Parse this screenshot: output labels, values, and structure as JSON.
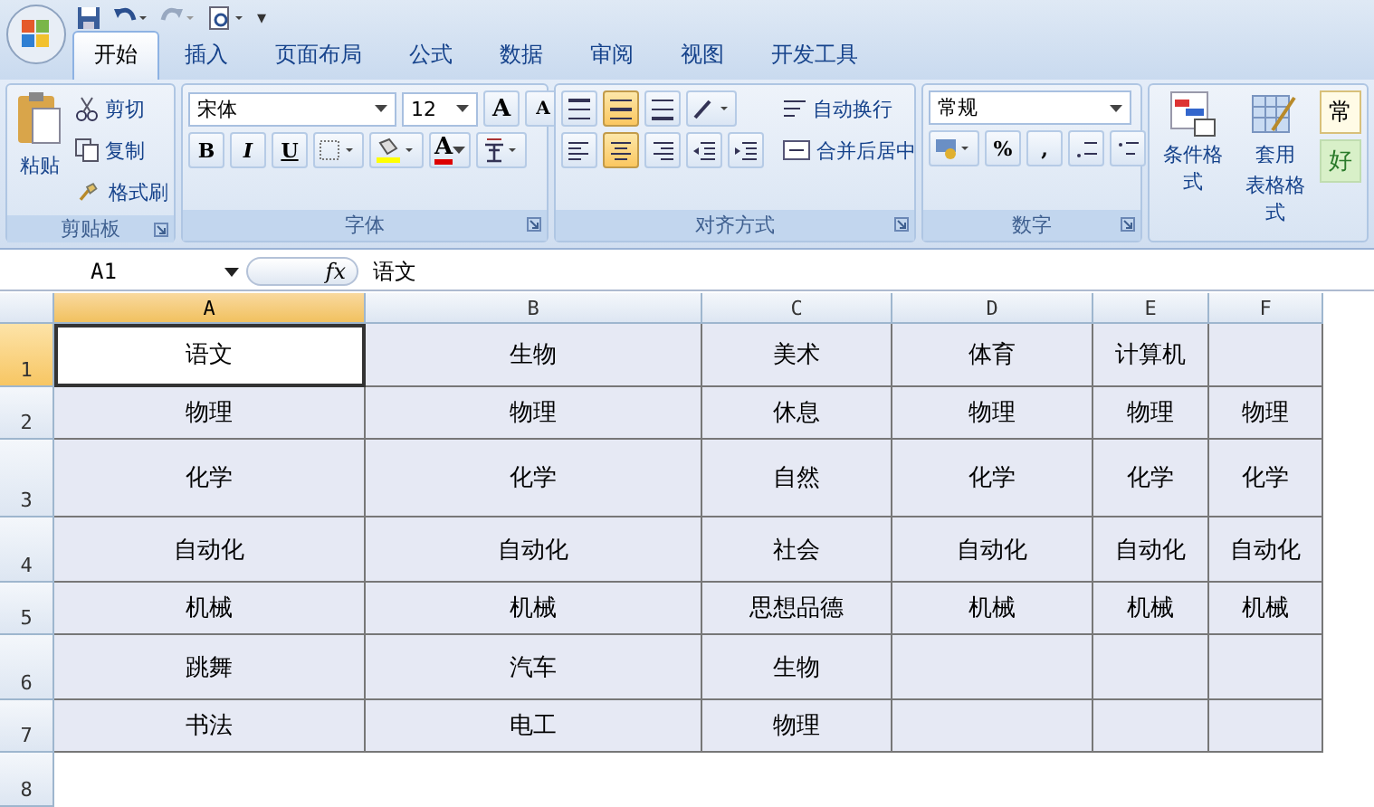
{
  "quick_access": {
    "more": "▾"
  },
  "tabs": [
    {
      "label": "开始",
      "selected": true
    },
    {
      "label": "插入",
      "selected": false
    },
    {
      "label": "页面布局",
      "selected": false
    },
    {
      "label": "公式",
      "selected": false
    },
    {
      "label": "数据",
      "selected": false
    },
    {
      "label": "审阅",
      "selected": false
    },
    {
      "label": "视图",
      "selected": false
    },
    {
      "label": "开发工具",
      "selected": false
    }
  ],
  "clipboard": {
    "title": "剪贴板",
    "paste": "粘贴",
    "cut": "剪切",
    "copy": "复制",
    "format_painter": "格式刷"
  },
  "font": {
    "title": "字体",
    "font_name": "宋体",
    "font_size": "12",
    "grow": "A",
    "shrink": "A",
    "bold": "B",
    "italic": "I",
    "underline": "U",
    "font_color": "A"
  },
  "alignment": {
    "title": "对齐方式",
    "vertical": [
      {
        "selected": false
      },
      {
        "selected": true
      },
      {
        "selected": false
      }
    ],
    "horizontal": [
      {
        "selected": false
      },
      {
        "selected": true
      },
      {
        "selected": false
      }
    ],
    "wrap_text": "自动换行",
    "merge_center": "合并后居中"
  },
  "number": {
    "title": "数字",
    "format": "常规",
    "percent": "%",
    "comma": ","
  },
  "styles": {
    "conditional_format": "条件格式",
    "table_format": [
      "套用",
      "表格格式"
    ],
    "cell_styles": [
      "常",
      "好"
    ]
  },
  "formula_bar": {
    "name_box": "A1",
    "fx": "fx",
    "formula": "语文"
  },
  "sheet": {
    "columns": [
      {
        "label": "A",
        "selected": true
      },
      {
        "label": "B",
        "selected": false
      },
      {
        "label": "C",
        "selected": false
      },
      {
        "label": "D",
        "selected": false
      },
      {
        "label": "E",
        "selected": false
      },
      {
        "label": "F",
        "selected": false
      }
    ],
    "rows": [
      {
        "header": "1",
        "selected": true,
        "cells": [
          {
            "text": "语文",
            "selected": true
          },
          {
            "text": "生物",
            "selected": false
          },
          {
            "text": "美术",
            "selected": false
          },
          {
            "text": "体育",
            "selected": false
          },
          {
            "text": "计算机",
            "selected": false
          },
          {
            "text": "",
            "selected": false
          }
        ]
      },
      {
        "header": "2",
        "selected": false,
        "cells": [
          {
            "text": "物理",
            "selected": false
          },
          {
            "text": "物理",
            "selected": false
          },
          {
            "text": "休息",
            "selected": false
          },
          {
            "text": "物理",
            "selected": false
          },
          {
            "text": "物理",
            "selected": false
          },
          {
            "text": "物理",
            "selected": false
          }
        ]
      },
      {
        "header": "3",
        "selected": false,
        "cells": [
          {
            "text": "化学",
            "selected": false
          },
          {
            "text": "化学",
            "selected": false
          },
          {
            "text": "自然",
            "selected": false
          },
          {
            "text": "化学",
            "selected": false
          },
          {
            "text": "化学",
            "selected": false
          },
          {
            "text": "化学",
            "selected": false
          }
        ]
      },
      {
        "header": "4",
        "selected": false,
        "cells": [
          {
            "text": "自动化",
            "selected": false
          },
          {
            "text": "自动化",
            "selected": false
          },
          {
            "text": "社会",
            "selected": false
          },
          {
            "text": "自动化",
            "selected": false
          },
          {
            "text": "自动化",
            "selected": false
          },
          {
            "text": "自动化",
            "selected": false
          }
        ]
      },
      {
        "header": "5",
        "selected": false,
        "cells": [
          {
            "text": "机械",
            "selected": false
          },
          {
            "text": "机械",
            "selected": false
          },
          {
            "text": "思想品德",
            "selected": false
          },
          {
            "text": "机械",
            "selected": false
          },
          {
            "text": "机械",
            "selected": false
          },
          {
            "text": "机械",
            "selected": false
          }
        ]
      },
      {
        "header": "6",
        "selected": false,
        "cells": [
          {
            "text": "跳舞",
            "selected": false
          },
          {
            "text": "汽车",
            "selected": false
          },
          {
            "text": "生物",
            "selected": false
          },
          {
            "text": "",
            "selected": false
          },
          {
            "text": "",
            "selected": false
          },
          {
            "text": "",
            "selected": false
          }
        ]
      },
      {
        "header": "7",
        "selected": false,
        "cells": [
          {
            "text": "书法",
            "selected": false
          },
          {
            "text": "电工",
            "selected": false
          },
          {
            "text": "物理",
            "selected": false
          },
          {
            "text": "",
            "selected": false
          },
          {
            "text": "",
            "selected": false
          },
          {
            "text": "",
            "selected": false
          }
        ]
      },
      {
        "header": "8",
        "selected": false,
        "cells": []
      }
    ]
  }
}
